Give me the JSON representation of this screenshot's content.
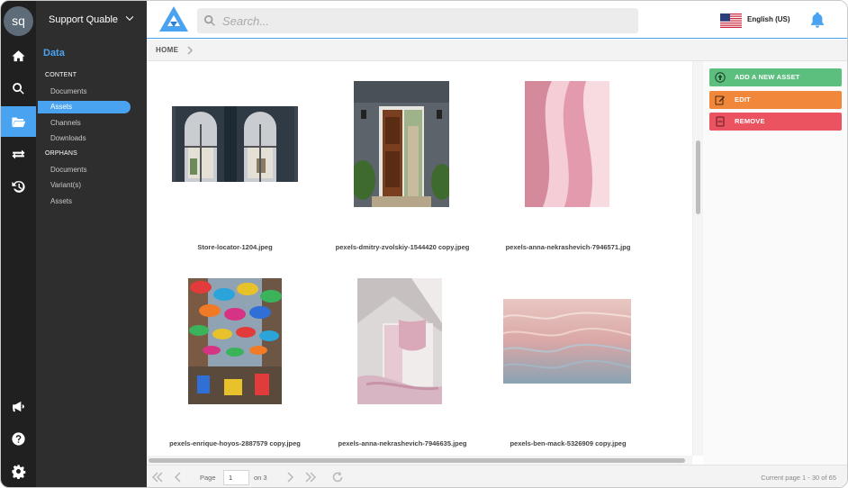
{
  "workspace": {
    "initials": "sq",
    "name": "Support Quable"
  },
  "rail": {
    "items": [
      "home-icon",
      "search-icon",
      "folder-icon",
      "exchange-icon",
      "history-icon"
    ],
    "bottom": [
      "megaphone-icon",
      "help-icon",
      "settings-icon"
    ],
    "active": "folder-icon"
  },
  "sidebar": {
    "title": "Data",
    "content_section": "CONTENT",
    "content_items": [
      "Documents",
      "Assets",
      "Channels",
      "Downloads"
    ],
    "orphans_section": "ORPHANS",
    "orphan_items": [
      "Documents",
      "Variant(s)",
      "Assets"
    ],
    "active_item": "Assets"
  },
  "topbar": {
    "search_placeholder": "Search...",
    "language": "English (US)"
  },
  "breadcrumb": {
    "home": "HOME"
  },
  "assets": [
    {
      "name": "Store-locator-1204.jpeg"
    },
    {
      "name": "pexels-dmitry-zvolskiy-1544420 copy.jpeg"
    },
    {
      "name": "pexels-anna-nekrashevich-7946571.jpg"
    },
    {
      "name": "pexels-enrique-hoyos-2887579 copy.jpeg"
    },
    {
      "name": "pexels-anna-nekrashevich-7946635.jpeg"
    },
    {
      "name": "pexels-ben-mack-5326909 copy.jpeg"
    }
  ],
  "actions": {
    "add": "ADD A NEW ASSET",
    "edit": "EDIT",
    "remove": "REMOVE"
  },
  "pagination": {
    "page_label": "Page",
    "current_page": "1",
    "of_label": "on 3",
    "status": "Current page 1 - 30 of 65"
  },
  "colors": {
    "accent": "#4aa3f0",
    "add": "#5cbf7e",
    "edit": "#f0873a",
    "remove": "#eb5360",
    "sidebar": "#2e2e2e",
    "rail": "#202020"
  }
}
